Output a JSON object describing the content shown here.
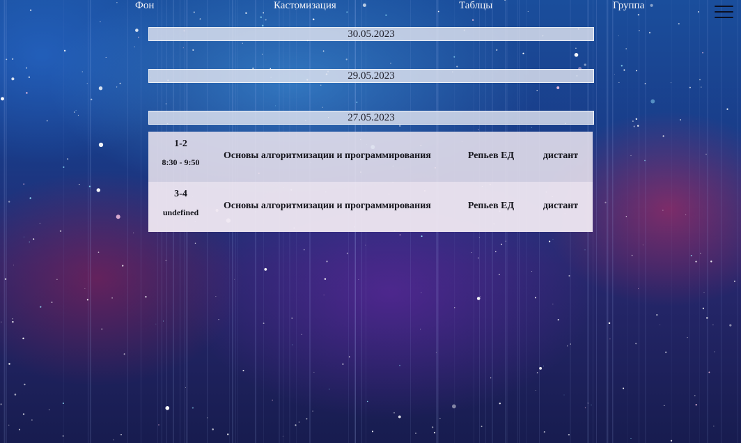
{
  "nav": {
    "items": [
      "Фон",
      "Кастомизация",
      "Таблцы",
      "Группа"
    ]
  },
  "dates": [
    "30.05.2023",
    "29.05.2023",
    "27.05.2023"
  ],
  "schedule": {
    "rows": [
      {
        "pair": "1-2",
        "time": "8:30 - 9:50",
        "subject": "Основы алгоритмизации и программирования",
        "teacher": "Репьев ЕД",
        "format": "дистант"
      },
      {
        "pair": "3-4",
        "time": "undefined",
        "subject": "Основы алгоритмизации и программирования",
        "teacher": "Репьев ЕД",
        "format": "дистант"
      }
    ]
  },
  "colors": {
    "date_bar": "#e1e4f0",
    "table_bg": "#e8e2ee",
    "nav_text": "#f3f3f8",
    "background_top": "#1a4e9c",
    "background_bottom": "#171c4f"
  },
  "icons": {
    "menu": "hamburger-menu-icon"
  }
}
